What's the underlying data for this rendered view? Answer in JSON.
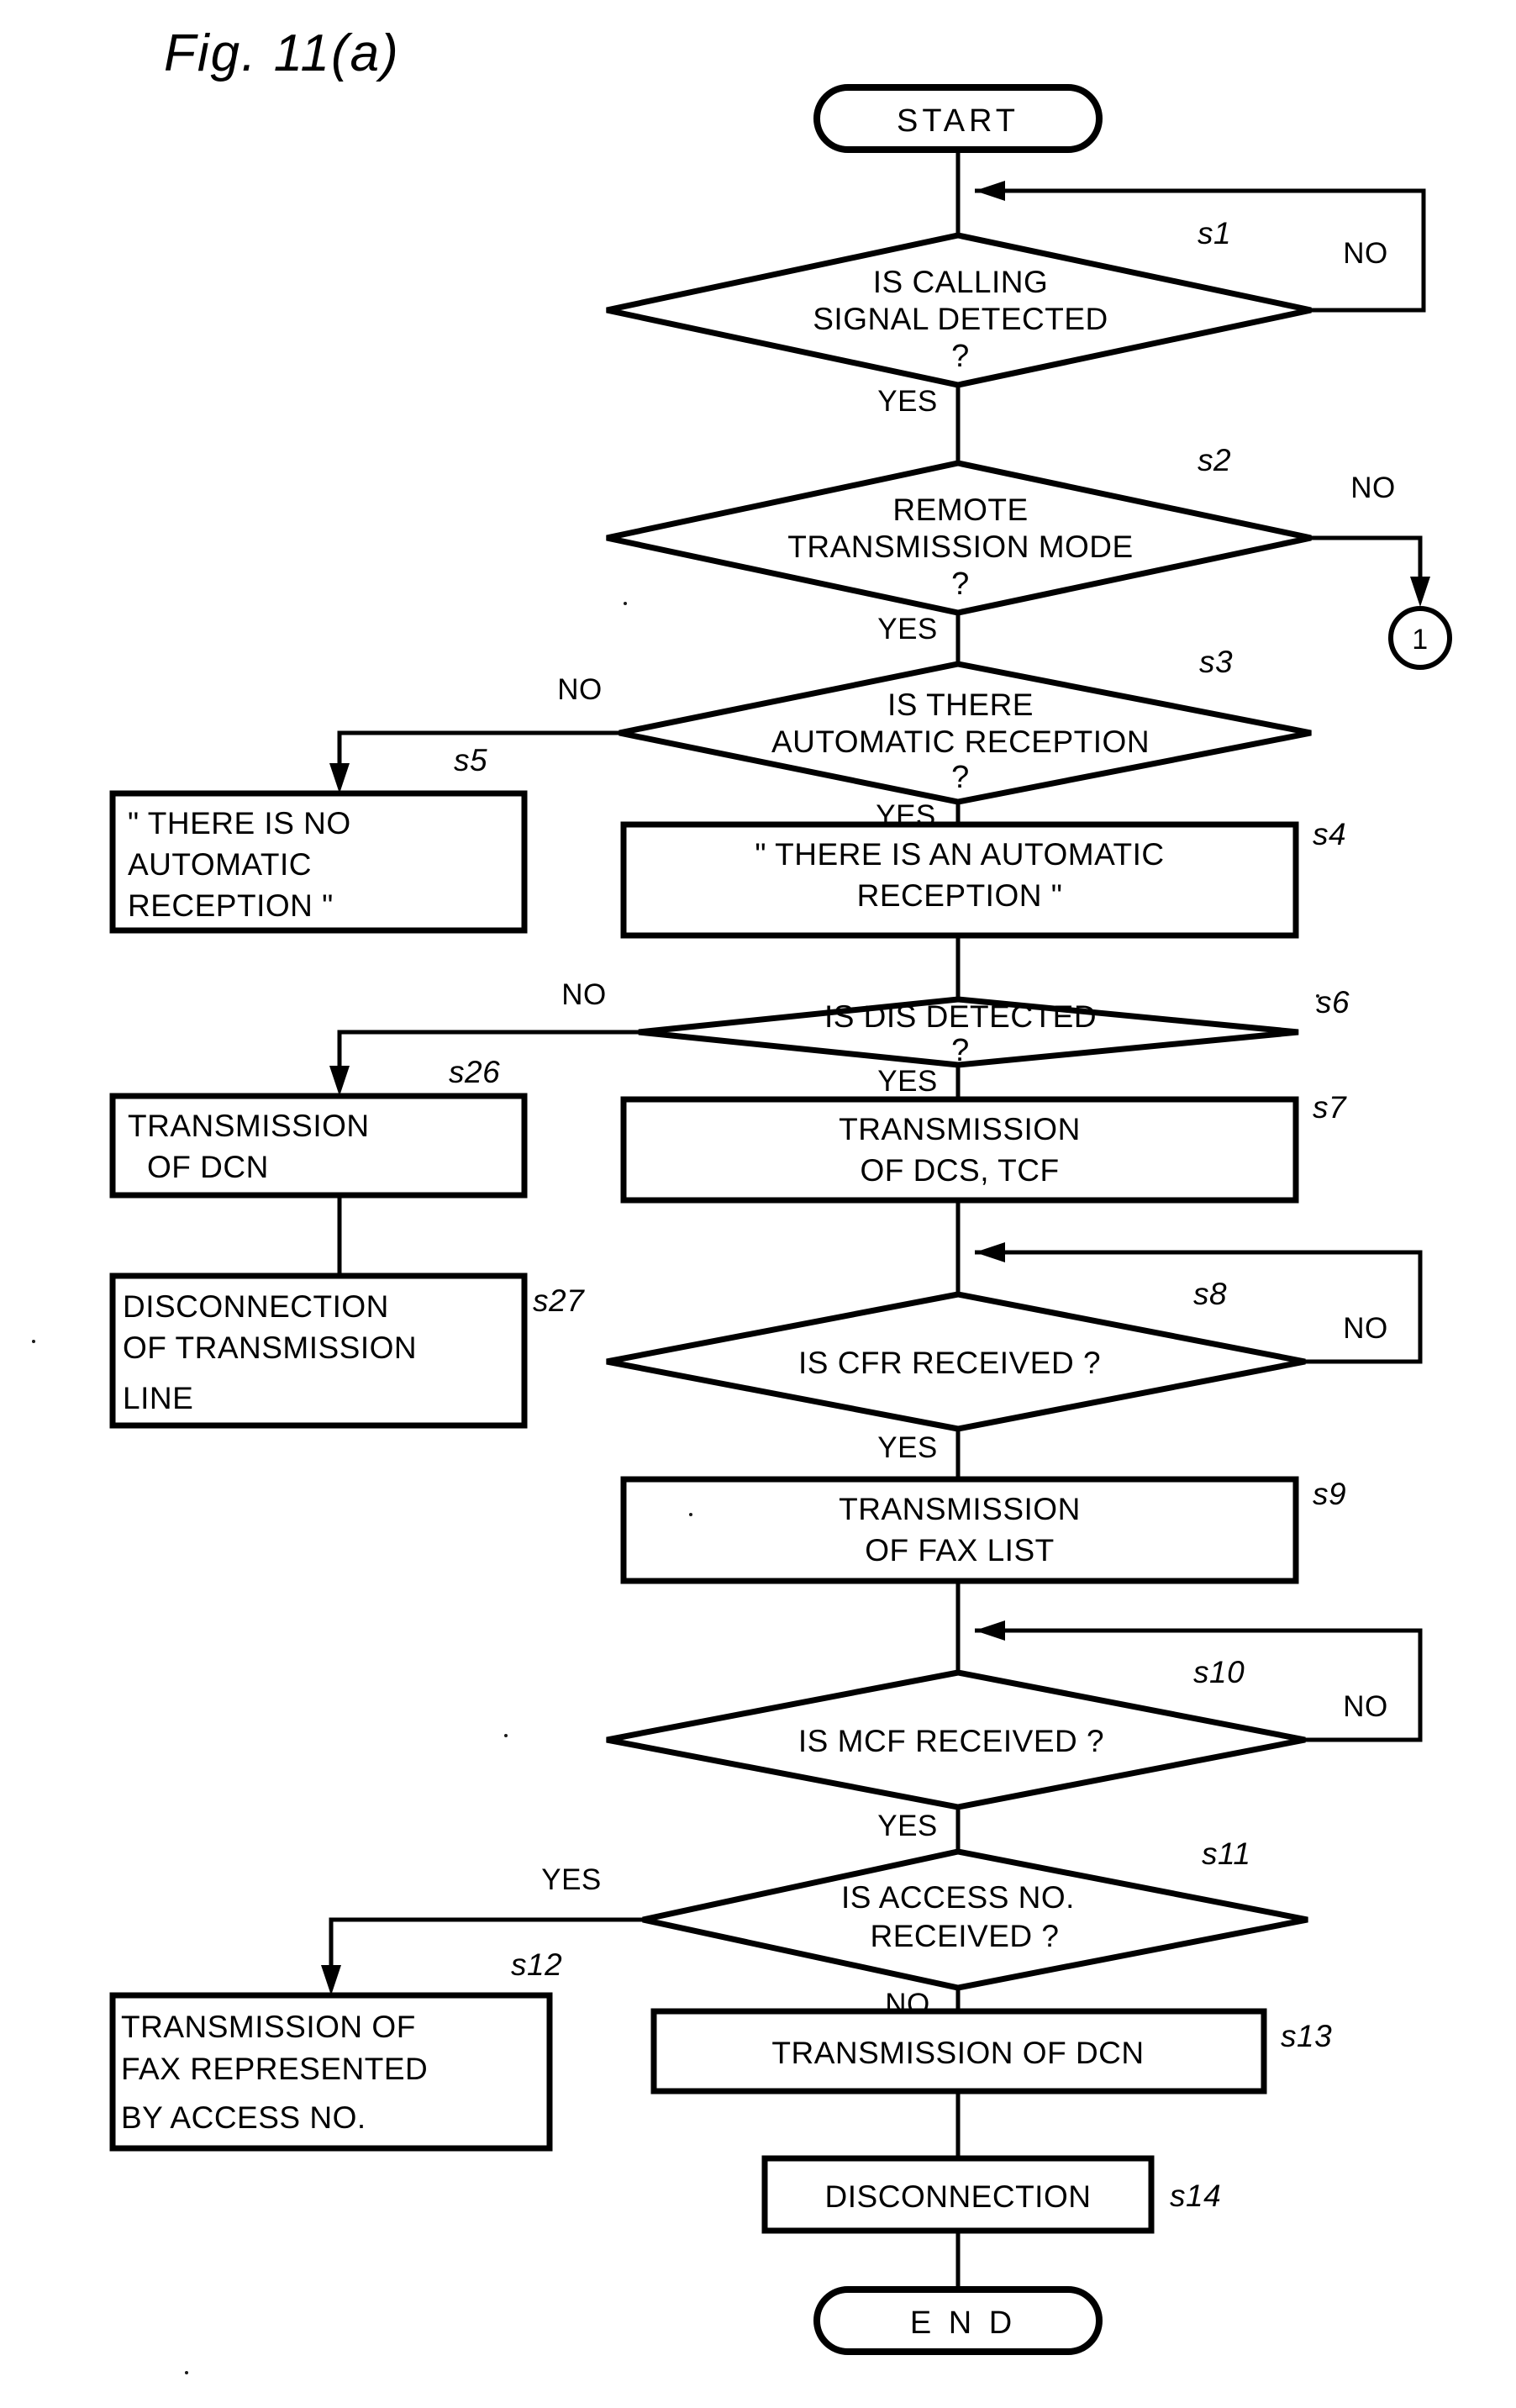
{
  "figure": {
    "title": "Fig. 11(a)",
    "type": "flowchart",
    "terminators": {
      "start": "START",
      "end": "E N D"
    },
    "connectors": [
      {
        "id": "conn-1",
        "label": "1",
        "from_step": "s2",
        "from_branch": "NO"
      }
    ],
    "nodes": [
      {
        "id": "s1",
        "step": "s1",
        "shape": "decision",
        "lines": [
          "IS CALLING",
          "SIGNAL DETECTED"
        ],
        "question_mark": "?",
        "branches": {
          "yes": "YES",
          "no": "NO"
        }
      },
      {
        "id": "s2",
        "step": "s2",
        "shape": "decision",
        "lines": [
          "REMOTE",
          "TRANSMISSION MODE"
        ],
        "question_mark": "?",
        "branches": {
          "yes": "YES",
          "no": "NO"
        }
      },
      {
        "id": "s3",
        "step": "s3",
        "shape": "decision",
        "lines": [
          "IS THERE",
          "AUTOMATIC RECEPTION"
        ],
        "question_mark": "?",
        "branches": {
          "yes": "YES",
          "no": "NO"
        }
      },
      {
        "id": "s5",
        "step": "s5",
        "shape": "process",
        "lines": [
          "\" THERE IS NO",
          "AUTOMATIC",
          "RECEPTION \""
        ]
      },
      {
        "id": "s4",
        "step": "s4",
        "shape": "process",
        "lines": [
          "\" THERE IS AN AUTOMATIC",
          "RECEPTION \""
        ]
      },
      {
        "id": "s6",
        "step": "s6",
        "shape": "decision",
        "lines": [
          "IS DIS DETECTED"
        ],
        "question_mark": "?",
        "branches": {
          "yes": "YES",
          "no": "NO"
        }
      },
      {
        "id": "s26",
        "step": "s26",
        "shape": "process",
        "lines": [
          "TRANSMISSION",
          "OF DCN"
        ]
      },
      {
        "id": "s7",
        "step": "s7",
        "shape": "process",
        "lines": [
          "TRANSMISSION",
          "OF DCS, TCF"
        ]
      },
      {
        "id": "s27",
        "step": "s27",
        "shape": "process",
        "lines": [
          "DISCONNECTION",
          "OF TRANSMISSION",
          "LINE"
        ]
      },
      {
        "id": "s8",
        "step": "s8",
        "shape": "decision",
        "lines": [
          "IS CFR RECEIVED ?"
        ],
        "branches": {
          "yes": "YES",
          "no": "NO"
        }
      },
      {
        "id": "s9",
        "step": "s9",
        "shape": "process",
        "lines": [
          "TRANSMISSION",
          "OF FAX  LIST"
        ]
      },
      {
        "id": "s10",
        "step": "s10",
        "shape": "decision",
        "lines": [
          "IS MCF RECEIVED ?"
        ],
        "branches": {
          "yes": "YES",
          "no": "NO"
        }
      },
      {
        "id": "s11",
        "step": "s11",
        "shape": "decision",
        "lines": [
          "IS ACCESS NO.",
          "RECEIVED ?"
        ],
        "branches": {
          "yes": "YES",
          "no": "NO"
        }
      },
      {
        "id": "s12",
        "step": "s12",
        "shape": "process",
        "lines": [
          "TRANSMISSION OF",
          "FAX REPRESENTED",
          "BY ACCESS NO."
        ]
      },
      {
        "id": "s13",
        "step": "s13",
        "shape": "process",
        "lines": [
          "TRANSMISSION OF DCN"
        ]
      },
      {
        "id": "s14",
        "step": "s14",
        "shape": "process",
        "lines": [
          "DISCONNECTION"
        ]
      }
    ],
    "colors": {
      "ink": "#000000",
      "paper": "#ffffff"
    }
  }
}
